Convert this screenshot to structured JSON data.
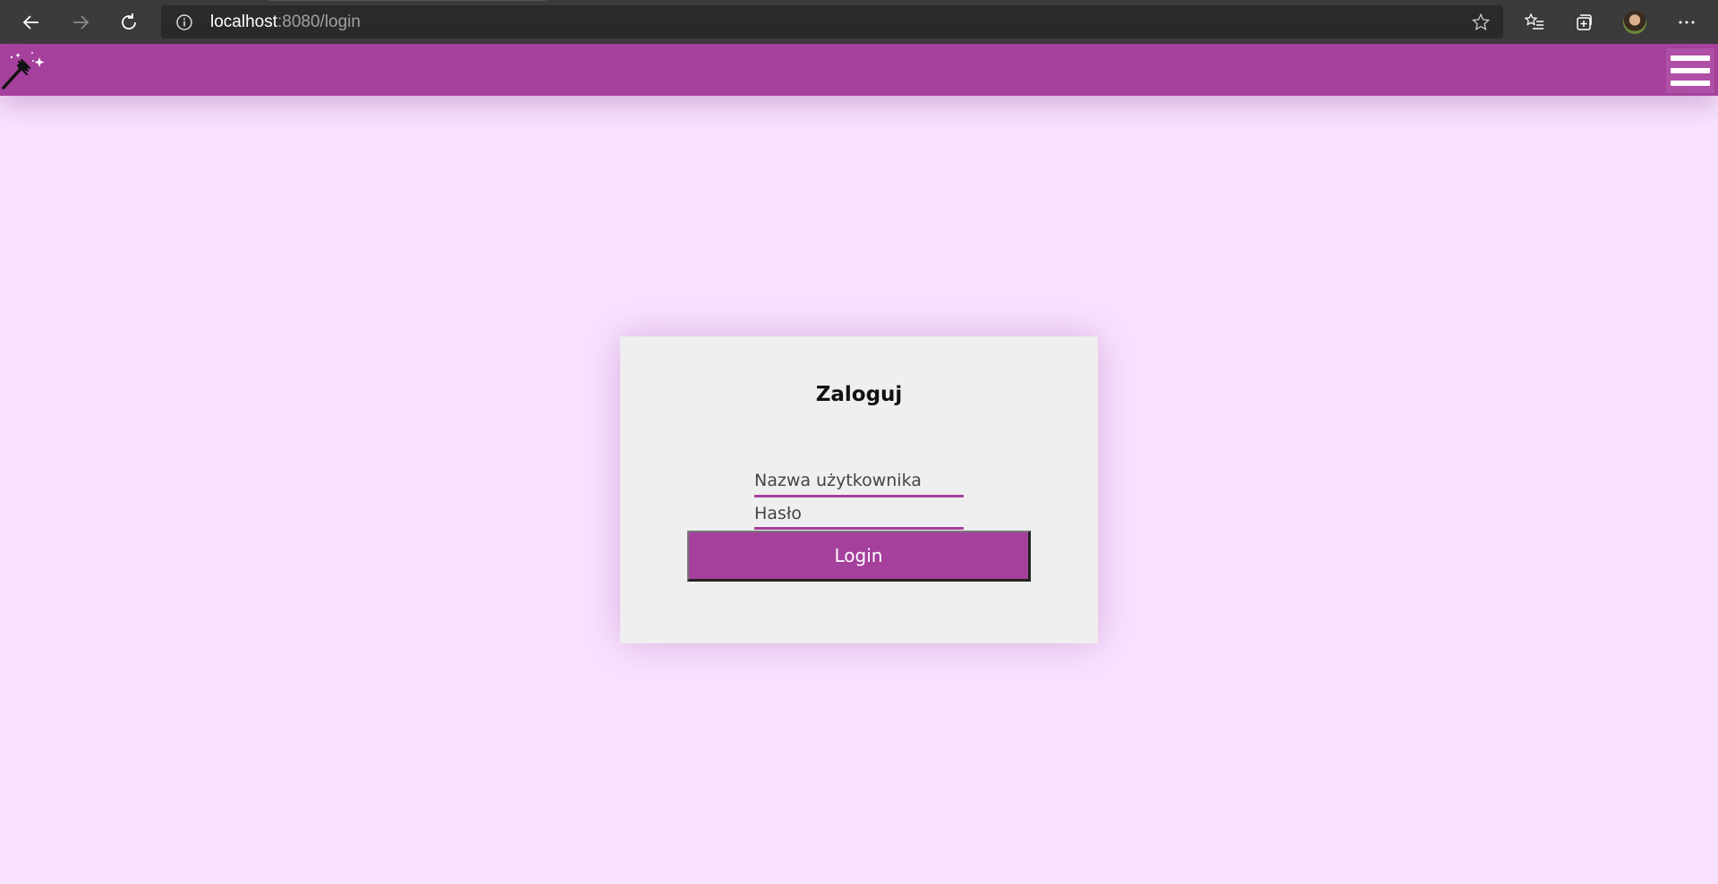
{
  "browser": {
    "url_host": "localhost",
    "url_path": ":8080/login"
  },
  "header": {
    "logo_icon": "magic-fork-icon",
    "menu_icon": "hamburger-menu-icon",
    "brand_color": "#a5409c"
  },
  "login": {
    "title": "Zaloguj",
    "username_placeholder": "Nazwa użytkownika",
    "password_placeholder": "Hasło",
    "button_label": "Login"
  }
}
